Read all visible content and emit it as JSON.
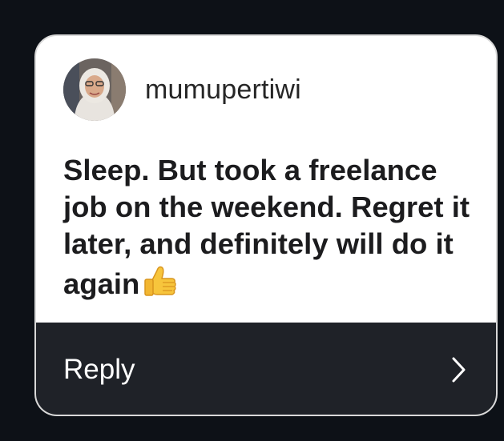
{
  "comment": {
    "username": "mumupertiwi",
    "avatar": "avatar",
    "message": "Sleep. But took a freelance job on the weekend. Regret it later, and definitely will do it again",
    "emoji": "thumbs-up-icon"
  },
  "reply_bar": {
    "label": "Reply",
    "icon": "chevron-right-icon"
  },
  "colors": {
    "background": "#0d1117",
    "card": "#ffffff",
    "reply_bar": "#1f2228",
    "text": "#1c1c1e"
  }
}
